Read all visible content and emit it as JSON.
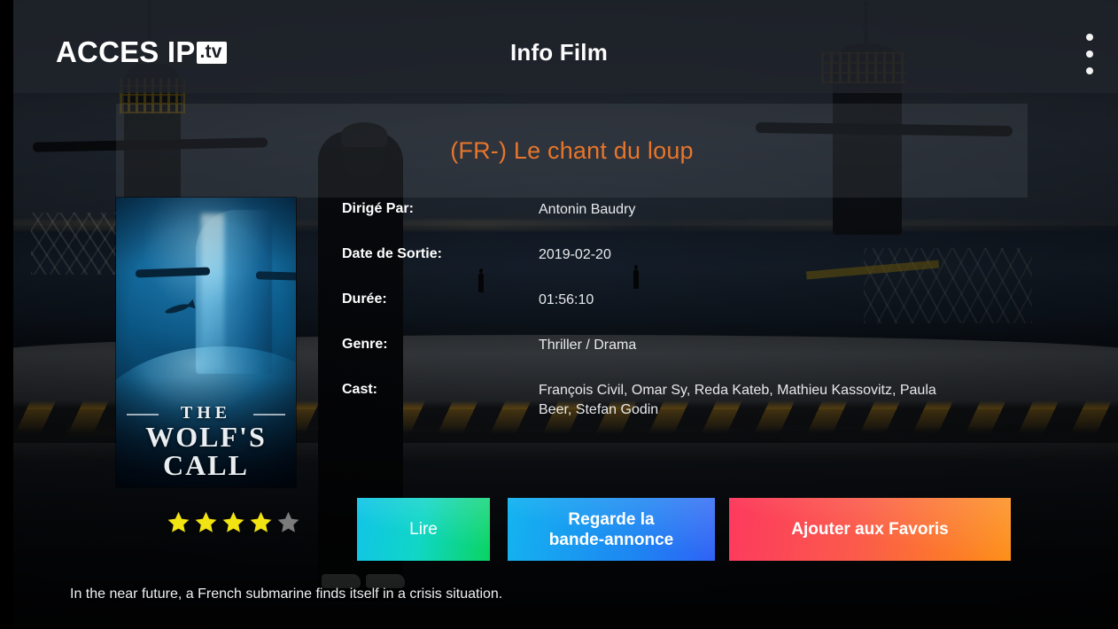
{
  "header": {
    "logo_main": "ACCES IP",
    "logo_suffix": ".tv",
    "title": "Info Film",
    "menu_icon": "overflow-menu-icon"
  },
  "movie": {
    "title": "(FR-) Le chant du loup",
    "title_color": "#e8752b",
    "poster": {
      "line1": "THE",
      "line2": "WOLF'S",
      "line3": "CALL"
    },
    "meta": [
      {
        "label": "Dirigé Par:",
        "value": "Antonin Baudry"
      },
      {
        "label": "Date de Sortie:",
        "value": "2019-02-20"
      },
      {
        "label": "Durée:",
        "value": "01:56:10"
      },
      {
        "label": "Genre:",
        "value": "Thriller / Drama"
      },
      {
        "label": "Cast:",
        "value": "François Civil, Omar Sy, Reda Kateb, Mathieu Kassovitz, Paula Beer, Stefan Godin"
      }
    ],
    "rating": {
      "filled": 4,
      "total": 5,
      "filled_color": "#f2e313",
      "empty_color": "#7b7b7b"
    },
    "description": "In the near future, a French submarine finds itself in a crisis situation."
  },
  "buttons": {
    "play": "Lire",
    "trailer_line1": "Regarde la",
    "trailer_line2": "bande-annonce",
    "favorite": "Ajouter aux Favoris"
  }
}
